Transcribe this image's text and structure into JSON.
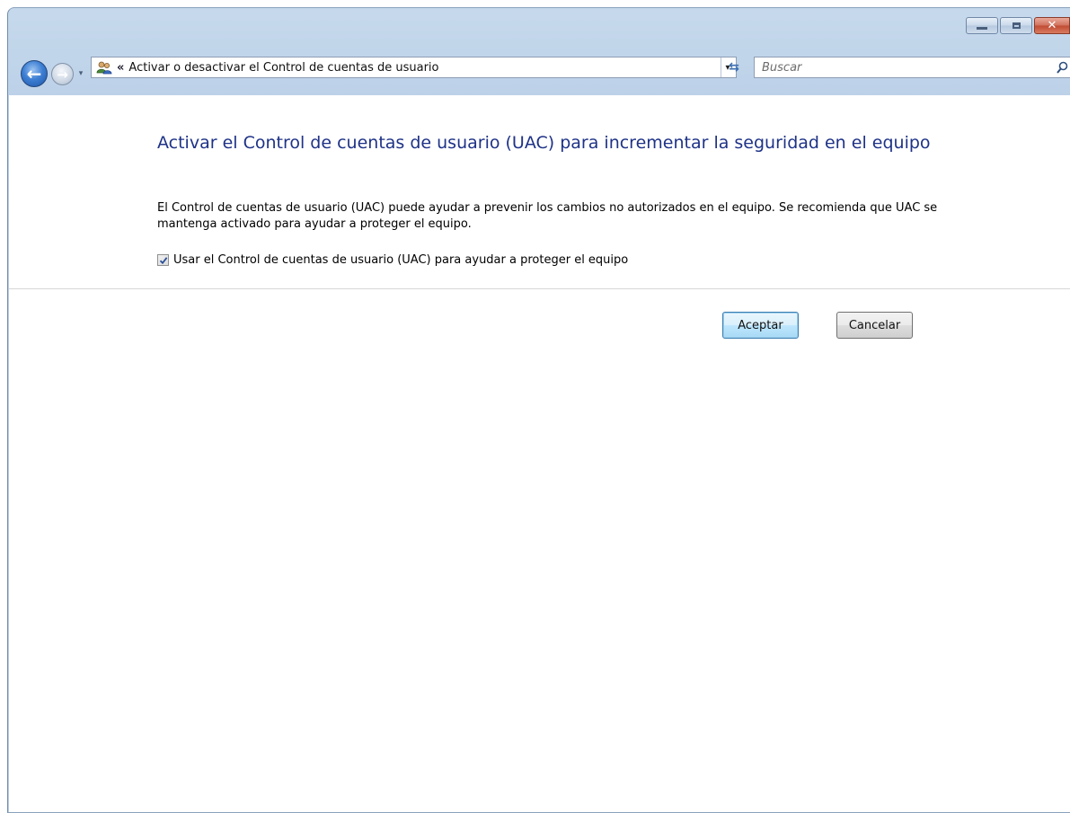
{
  "window": {
    "caption_buttons": {
      "minimize_icon": "minimize-icon",
      "maximize_icon": "maximize-icon",
      "close_glyph": "✕"
    }
  },
  "navigation": {
    "back_glyph": "←",
    "forward_glyph": "→",
    "recent_glyph": "▾",
    "address": {
      "icon": "user-accounts-icon",
      "chevrons": "«",
      "text": "Activar o desactivar el Control de cuentas de usuario",
      "dropdown_glyph": "▾"
    },
    "refresh_glyph": "⇆",
    "search": {
      "placeholder": "Buscar",
      "value": ""
    }
  },
  "content": {
    "title": "Activar el Control de cuentas de usuario (UAC) para incrementar la seguridad en el equipo",
    "description": "El Control de cuentas de usuario (UAC) puede ayudar a prevenir los cambios no autorizados en el equipo. Se recomienda que UAC se mantenga activado para ayudar a proteger el equipo.",
    "checkbox": {
      "label": "Usar el Control de cuentas de usuario (UAC) para ayudar a proteger el equipo",
      "checked": true
    }
  },
  "buttons": {
    "ok_label": "Aceptar",
    "cancel_label": "Cancelar"
  },
  "colors": {
    "title_blue": "#1e3287",
    "frame_blue": "#bcd1e8",
    "close_red": "#c14a33"
  }
}
